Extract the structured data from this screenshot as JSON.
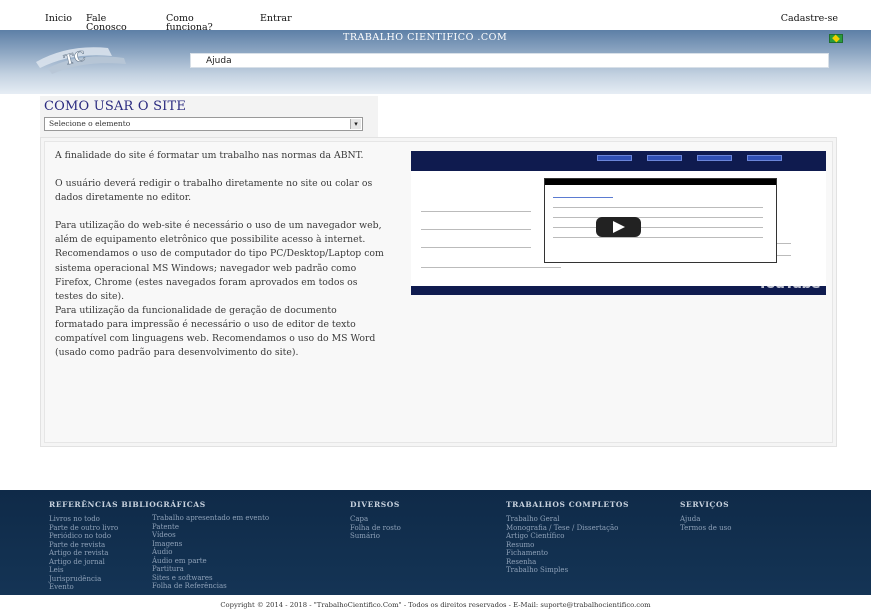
{
  "nav": {
    "inicio": "Inicio",
    "fale": "Fale Conosco",
    "como": "Como funciona?",
    "entrar": "Entrar",
    "cadastre": "Cadastre-se"
  },
  "header": {
    "site_title": "TRABALHO CIENTIFICO .COM",
    "help_label": "Ajuda",
    "flag_icon": "brazil-flag-icon"
  },
  "help": {
    "title": "COMO USAR O SITE",
    "select_value": "Selecione o elemento",
    "paragraphs": [
      "A finalidade do site é formatar um trabalho nas normas da ABNT.",
      "O usuário deverá redigir o trabalho diretamente no site ou colar os dados diretamente no editor.",
      "Para utilização do web-site é necessário o uso de um navegador web, além de equipamento eletrônico que possibilite acesso à internet. Recomendamos o uso de computador do tipo PC/Desktop/Laptop com sistema operacional MS Windows; navegador web padrão como Firefox, Chrome (estes navegados foram aprovados em todos os testes do site).",
      "Para utilização da funcionalidade de geração de documento formatado para impressão é necessário o uso de editor de texto compatível com linguagens web. Recomendamos o uso do MS Word (usado como padrão para desenvolvimento do site)."
    ],
    "video_brand": "YouTube"
  },
  "footer": {
    "ref_title": "REFERÊNCIAS BIBLIOGRÁFICAS",
    "ref_col1": [
      "Livros no todo",
      "Parte de outro livro",
      "Periódico no todo",
      "Parte de revista",
      "Artigo de revista",
      "Artigo de jornal",
      "Leis",
      "Jurisprudência",
      "Evento"
    ],
    "ref_col2": [
      "Trabalho apresentado em evento",
      "Patente",
      "Vídeos",
      "Imagens",
      "Áudio",
      "Áudio em parte",
      "Partitura",
      "Sites e softwares",
      "Folha de Referências"
    ],
    "div_title": "DIVERSOS",
    "div_items": [
      "Capa",
      "Folha de rosto",
      "Sumário"
    ],
    "trab_title": "TRABALHOS COMPLETOS",
    "trab_items": [
      "Trabalho Geral",
      "Monografia / Tese / Dissertação",
      "Artigo Científico",
      "Resumo",
      "Fichamento",
      "Resenha",
      "Trabalho Simples"
    ],
    "serv_title": "SERVIÇOS",
    "serv_items": [
      "Ajuda",
      "Termos de uso"
    ]
  },
  "copyright": "Copyright © 2014 - 2018 - \"TrabalhoCientifico.Com\" - Todos os direitos reservados  -  E-Mail: suporte@trabalhocientifico.com"
}
